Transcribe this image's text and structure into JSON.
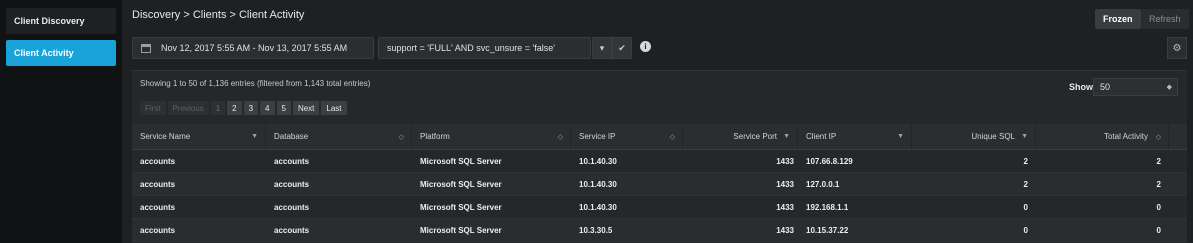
{
  "sidebar": {
    "items": [
      {
        "label": "Client Discovery",
        "active": false
      },
      {
        "label": "Client Activity",
        "active": true
      }
    ]
  },
  "header": {
    "breadcrumb": "Discovery > Clients > Client Activity",
    "frozen_label": "Frozen",
    "refresh_label": "Refresh"
  },
  "toolbar": {
    "date_range": "Nov 12, 2017 5:55 AM - Nov 13, 2017 5:55 AM",
    "filter_value": "support = 'FULL' AND svc_unsure = 'false'",
    "caret_icon": "▾",
    "check_icon": "✔",
    "info_icon": "i",
    "gear_icon": "⚙"
  },
  "table_info": {
    "summary": "Showing 1 to 50 of 1,136 entries (filtered from 1,143 total entries)",
    "show_label": "Show:",
    "show_value": "50",
    "pager": {
      "first": "First",
      "previous": "Previous",
      "pages": [
        "1",
        "2",
        "3",
        "4",
        "5"
      ],
      "next": "Next",
      "last": "Last"
    }
  },
  "table": {
    "columns": [
      {
        "label": "Service Name",
        "sort": "▼"
      },
      {
        "label": "Database",
        "sort": "◇"
      },
      {
        "label": "Platform",
        "sort": "◇"
      },
      {
        "label": "Service IP",
        "sort": "◇"
      },
      {
        "label": "Service Port",
        "sort": "▼"
      },
      {
        "label": "Client IP",
        "sort": "▼"
      },
      {
        "label": "Unique SQL",
        "sort": "▼"
      },
      {
        "label": "Total Activity",
        "sort": "◇"
      }
    ],
    "rows": [
      [
        "accounts",
        "accounts",
        "Microsoft SQL Server",
        "10.1.40.30",
        "1433",
        "107.66.8.129",
        "2",
        "2"
      ],
      [
        "accounts",
        "accounts",
        "Microsoft SQL Server",
        "10.1.40.30",
        "1433",
        "127.0.0.1",
        "2",
        "2"
      ],
      [
        "accounts",
        "accounts",
        "Microsoft SQL Server",
        "10.1.40.30",
        "1433",
        "192.168.1.1",
        "0",
        "0"
      ],
      [
        "accounts",
        "accounts",
        "Microsoft SQL Server",
        "10.3.30.5",
        "1433",
        "10.15.37.22",
        "0",
        "0"
      ]
    ]
  }
}
